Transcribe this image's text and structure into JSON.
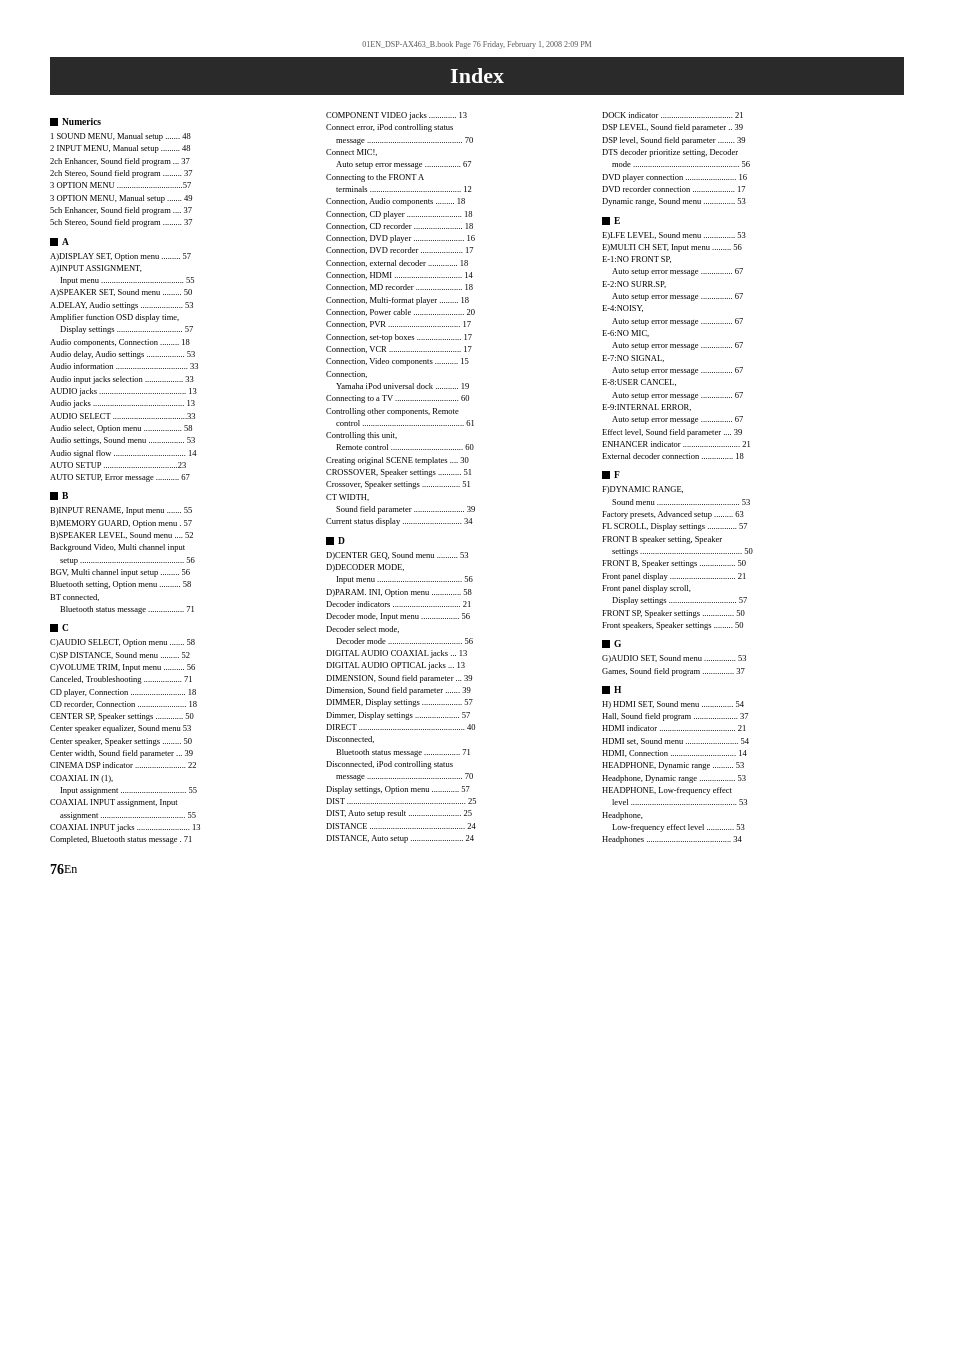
{
  "meta": {
    "file_info": "01EN_DSP-AX463_B.book  Page 76  Friday, February 1, 2008  2:09 PM"
  },
  "page_title": "Index",
  "page_number": "76",
  "page_number_suffix": " En",
  "columns": {
    "left": {
      "sections": [
        {
          "heading": "Numerics",
          "entries": [
            "1 SOUND MENU, Manual setup  ....... 48",
            "2 INPUT MENU, Manual setup  ......... 48",
            "2ch Enhancer, Sound field program  ... 37",
            "2ch Stereo, Sound field program  ......... 37",
            "3 OPTION MENU  ...............................57",
            "3 OPTION MENU, Manual setup  ....... 49",
            "5ch Enhancer, Sound field program  .... 37",
            "5ch Stereo, Sound field program  ......... 37"
          ]
        },
        {
          "heading": "A",
          "entries": [
            "A)DISPLAY SET, Option menu  ......... 57",
            "A)INPUT ASSIGNMENT,",
            {
              "indent": "Input menu ....................................... 55"
            },
            "A)SPEAKER SET, Sound menu  ......... 50",
            "A.DELAY, Audio settings  .................... 53",
            "Amplifier function OSD display time,",
            {
              "indent": "Display settings  ............................... 57"
            },
            "Audio components, Connection  ......... 18",
            "Audio delay, Audio settings  .................. 53",
            "Audio information .................................. 33",
            "Audio input jacks selection  .................. 33",
            "AUDIO jacks  ......................................... 13",
            "Audio jacks  ........................................... 13",
            "AUDIO SELECT  ...................................33",
            "Audio select, Option menu  .................. 58",
            "Audio settings, Sound menu  ................. 53",
            "Audio signal flow  .................................. 14",
            "AUTO SETUP  ...................................23",
            "AUTO SETUP, Error message  ........... 67"
          ]
        },
        {
          "heading": "B",
          "entries": [
            "B)INPUT RENAME, Input menu  ....... 55",
            "B)MEMORY GUARD, Option menu  . 57",
            "B)SPEAKER LEVEL, Sound menu  .... 52",
            "Background Video, Multi channel input",
            {
              "indent": "setup ................................................. 56"
            },
            "BGV, Multi channel input setup  ......... 56",
            "Bluetooth setting, Option menu  .......... 58",
            "BT connected,",
            {
              "indent": "Bluetooth status message  ................. 71"
            }
          ]
        },
        {
          "heading": "C",
          "entries": [
            "C)AUDIO SELECT, Option menu  ....... 58",
            "C)SP DISTANCE, Sound menu  ......... 52",
            "C)VOLUME TRIM, Input menu  .......... 56",
            "Canceled, Troubleshooting  .................. 71",
            "CD player, Connection  .......................... 18",
            "CD recorder, Connection  ....................... 18",
            "CENTER SP, Speaker settings  ............. 50",
            "Center speaker equalizer, Sound menu  53",
            "Center speaker, Speaker settings  ......... 50",
            "Center width, Sound field parameter  ... 39",
            "CINEMA DSP indicator  ........................ 22",
            "COAXIAL IN (1),",
            {
              "indent": "Input assignment  ............................... 55"
            },
            "COAXIAL INPUT assignment, Input",
            {
              "indent": "assignment  ........................................ 55"
            },
            "COAXIAL INPUT jacks  ......................... 13",
            "Completed, Bluetooth status message  . 71"
          ]
        }
      ]
    },
    "middle": {
      "sections": [
        {
          "heading": "",
          "entries": [
            "COMPONENT VIDEO jacks  ............. 13",
            "Connect error, iPod controlling status",
            {
              "indent": "message  ............................................. 70"
            },
            "Connect MIC!,",
            {
              "indent": "Auto setup error message  ................. 67"
            },
            "Connecting to the FRONT A",
            {
              "indent": "terminals  ........................................... 12"
            },
            "Connection, Audio components  ......... 18",
            "Connection, CD player  .......................... 18",
            "Connection, CD recorder  ....................... 18",
            "Connection, DVD player  ........................ 16",
            "Connection, DVD recorder  .................... 17",
            "Connection, external decoder  .............. 18",
            "Connection, HDMI  ................................ 14",
            "Connection, MD recorder  ...................... 18",
            "Connection, Multi-format player  ......... 18",
            "Connection, Power cable  ........................ 20",
            "Connection, PVR  .................................. 17",
            "Connection, set-top boxes  ..................... 17",
            "Connection, VCR  .................................. 17",
            "Connection, Video components  ........... 15",
            "Connection,",
            {
              "indent": "Yamaha iPod universal dock  ........... 19"
            },
            "Connecting to a TV  .............................. 60",
            "Controlling other components, Remote",
            {
              "indent": "control  ................................................ 61"
            },
            "Controlling this unit,",
            {
              "indent": "Remote control  .................................. 60"
            },
            "Creating original SCENE templates  .... 30",
            "CROSSOVER, Speaker settings  ........... 51",
            "Crossover, Speaker settings  .................. 51",
            "CT WIDTH,",
            {
              "indent": "Sound field parameter  ........................ 39"
            },
            "Current status display  ............................ 34"
          ]
        },
        {
          "heading": "D",
          "entries": [
            "D)CENTER GEQ, Sound menu  .......... 53",
            "D)DECODER MODE,",
            {
              "indent": "Input menu  ........................................ 56"
            },
            "D)PARAM. INI, Option menu  .............. 58",
            "Decoder indicators  ................................ 21",
            "Decoder mode, Input menu  .................. 56",
            "Decoder select mode,",
            {
              "indent": "Decoder mode  ................................... 56"
            },
            "DIGITAL AUDIO COAXIAL jacks  ... 13",
            "DIGITAL AUDIO OPTICAL jacks  ... 13",
            "DIMENSION, Sound field parameter  ... 39",
            "Dimension, Sound field parameter  ....... 39",
            "DIMMER, Display settings  ................... 57",
            "Dimmer, Display settings  ..................... 57",
            "DIRECT  .................................................. 40",
            "Disconnected,",
            {
              "indent": "Bluetooth status message  ................. 71"
            },
            "Disconnected, iPod controlling status",
            {
              "indent": "message  ............................................. 70"
            },
            "Display settings, Option menu  ............. 57",
            "DIST  ........................................................ 25",
            "DIST, Auto setup result  ......................... 25",
            "DISTANCE  ............................................. 24",
            "DISTANCE, Auto setup  ......................... 24"
          ]
        }
      ]
    },
    "right": {
      "sections": [
        {
          "heading": "",
          "entries": [
            "DOCK indicator  .................................. 21",
            "DSP LEVEL, Sound field parameter  .. 39",
            "DSP level, Sound field parameter  ........ 39",
            "DTS decoder prioritize setting, Decoder",
            {
              "indent": "mode  .................................................. 56"
            },
            "DVD player connection  ........................ 16",
            "DVD recorder connection  .................... 17",
            "Dynamic range, Sound menu  ............... 53"
          ]
        },
        {
          "heading": "E",
          "entries": [
            "E)LFE LEVEL, Sound menu  ............... 53",
            "E)MULTI CH SET, Input menu  ......... 56",
            "E-1:NO FRONT SP,",
            {
              "indent": "Auto setup error message  ............... 67"
            },
            "E-2:NO SURR.SP,",
            {
              "indent": "Auto setup error message  ............... 67"
            },
            "E-4:NOISY,",
            {
              "indent": "Auto setup error message  ............... 67"
            },
            "E-6:NO MIC,",
            {
              "indent": "Auto setup error message  ............... 67"
            },
            "E-7:NO SIGNAL,",
            {
              "indent": "Auto setup error message  ............... 67"
            },
            "E-8:USER CANCEL,",
            {
              "indent": "Auto setup error message  ............... 67"
            },
            "E-9:INTERNAL ERROR,",
            {
              "indent": "Auto setup error message  ............... 67"
            },
            "Effect level, Sound field parameter  .... 39",
            "ENHANCER indicator  ........................... 21",
            "External decoder connection  ............... 18"
          ]
        },
        {
          "heading": "F",
          "entries": [
            "F)DYNAMIC RANGE,",
            {
              "indent": "Sound menu  ....................................... 53"
            },
            "Factory presets, Advanced setup  ......... 63",
            "FL SCROLL, Display settings  .............. 57",
            "FRONT B speaker setting, Speaker",
            {
              "indent": "settings  ................................................ 50"
            },
            "FRONT B, Speaker settings  ................. 50",
            "Front panel display  ............................... 21",
            "Front panel display scroll,",
            {
              "indent": "Display settings  ................................ 57"
            },
            "FRONT SP, Speaker settings  ............... 50",
            "Front speakers, Speaker settings  ......... 50"
          ]
        },
        {
          "heading": "G",
          "entries": [
            "G)AUDIO SET, Sound menu  ............... 53",
            "Games, Sound field program  ............... 37"
          ]
        },
        {
          "heading": "H",
          "entries": [
            "H) HDMI SET, Sound menu  ............... 54",
            "Hall, Sound field program  ..................... 37",
            "HDMI indicator  .................................... 21",
            "HDMI set, Sound menu  ......................... 54",
            "HDMI, Connection  ............................... 14",
            "HEADPHONE, Dynamic range  .......... 53",
            "Headphone, Dynamic range  ................. 53",
            "HEADPHONE, Low-frequency effect",
            {
              "indent": "level  .................................................. 53"
            },
            "Headphone,",
            {
              "indent": "Low-frequency effect level  ............. 53"
            },
            "Headphones  ........................................ 34"
          ]
        }
      ]
    }
  }
}
